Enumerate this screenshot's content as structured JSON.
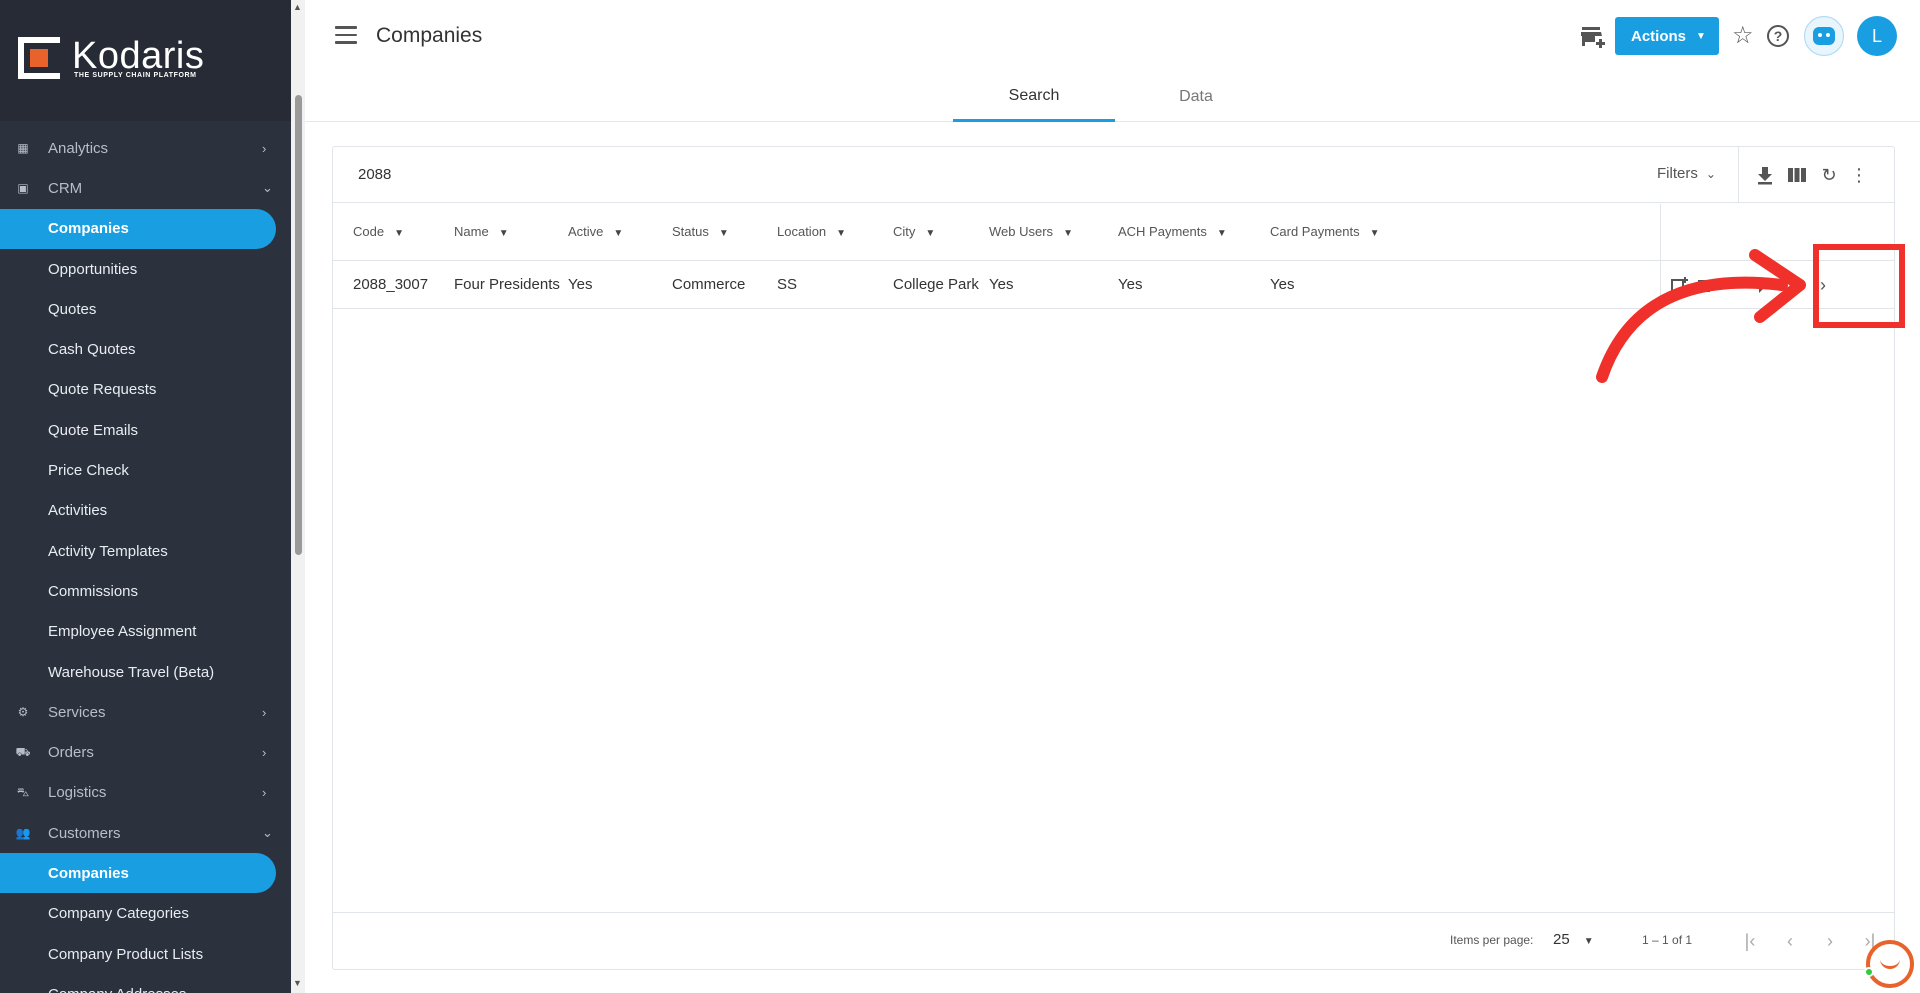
{
  "brand": {
    "name": "Kodaris",
    "tagline": "THE SUPPLY CHAIN PLATFORM",
    "accent": "#1a9ee2",
    "logo_color": "#e8622b"
  },
  "sidebar": {
    "items": [
      {
        "label": "Analytics",
        "icon": "analytics-icon",
        "chevron": "›"
      },
      {
        "label": "CRM",
        "icon": "crm-icon",
        "chevron": "⌄"
      },
      {
        "label": "Companies",
        "sub": true,
        "active": true
      },
      {
        "label": "Opportunities",
        "sub": true
      },
      {
        "label": "Quotes",
        "sub": true
      },
      {
        "label": "Cash Quotes",
        "sub": true
      },
      {
        "label": "Quote Requests",
        "sub": true
      },
      {
        "label": "Quote Emails",
        "sub": true
      },
      {
        "label": "Price Check",
        "sub": true
      },
      {
        "label": "Activities",
        "sub": true
      },
      {
        "label": "Activity Templates",
        "sub": true
      },
      {
        "label": "Commissions",
        "sub": true
      },
      {
        "label": "Employee Assignment",
        "sub": true
      },
      {
        "label": "Warehouse Travel (Beta)",
        "sub": true
      },
      {
        "label": "Services",
        "icon": "services-icon",
        "chevron": "›"
      },
      {
        "label": "Orders",
        "icon": "orders-icon",
        "chevron": "›"
      },
      {
        "label": "Logistics",
        "icon": "logistics-icon",
        "chevron": "›"
      },
      {
        "label": "Customers",
        "icon": "customers-icon",
        "chevron": "⌄"
      },
      {
        "label": "Companies",
        "sub": true,
        "active": true
      },
      {
        "label": "Company Categories",
        "sub": true
      },
      {
        "label": "Company Product Lists",
        "sub": true
      },
      {
        "label": "Company Addresses",
        "sub": true
      }
    ]
  },
  "header": {
    "title": "Companies",
    "actions_label": "Actions",
    "avatar_initial": "L"
  },
  "tabs": [
    {
      "label": "Search",
      "active": true
    },
    {
      "label": "Data",
      "active": false
    }
  ],
  "search": {
    "value": "2088",
    "filters_label": "Filters"
  },
  "table": {
    "columns": [
      "Code",
      "Name",
      "Active",
      "Status",
      "Location",
      "City",
      "Web Users",
      "ACH Payments",
      "Card Payments"
    ],
    "rows": [
      [
        "2088_3007",
        "Four Presidents",
        "Yes",
        "Commerce",
        "SS",
        "College Park",
        "Yes",
        "Yes",
        "Yes"
      ]
    ]
  },
  "pagination": {
    "items_per_page_label": "Items per page:",
    "items_per_page": "25",
    "range": "1 – 1 of 1"
  },
  "annotation": {
    "highlight_color": "#f0302a"
  }
}
